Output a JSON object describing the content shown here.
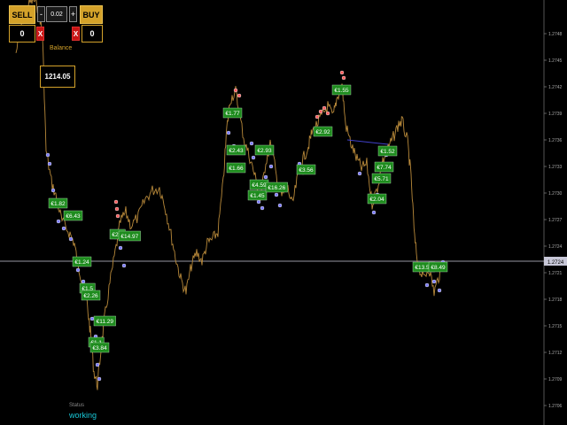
{
  "panel": {
    "sell_label": "SELL",
    "buy_label": "BUY",
    "minus_label": "-",
    "plus_label": "+",
    "lot": "0.02",
    "sell_count": "0",
    "buy_count": "0",
    "close_label": "X",
    "balance_label": "Balance",
    "balance_value": "1214.05"
  },
  "status": {
    "label": "Status",
    "value": "working"
  },
  "price_axis": {
    "ticks": [
      "1.2748",
      "1.2745",
      "1.2742",
      "1.2739",
      "1.2736",
      "1.2733",
      "1.2730",
      "1.2727",
      "1.2724",
      "1.2721",
      "1.2718",
      "1.2715",
      "1.2712",
      "1.2709",
      "1.2706"
    ],
    "current": "1.2724"
  },
  "chart_data": {
    "type": "line",
    "colors": {
      "price": "#b8893a",
      "current_line": "#c8c8d8",
      "label_bg": "#1e8c1e"
    },
    "trade_labels": [
      "€1.77",
      "€1.55",
      "€2.43",
      "€1.66",
      "€2.93",
      "€4.59",
      "€1.45",
      "€16.26",
      "€3.56",
      "€2.92",
      "€1.52",
      "€7.74",
      "€5.71",
      "€2.04",
      "€1.82",
      "€6.43",
      "€2.6",
      "€14.97",
      "€1.24",
      "€1.5",
      "€2.26",
      "€11.29",
      "€1.1",
      "€3.84",
      "€13.55",
      "€8.49"
    ]
  }
}
